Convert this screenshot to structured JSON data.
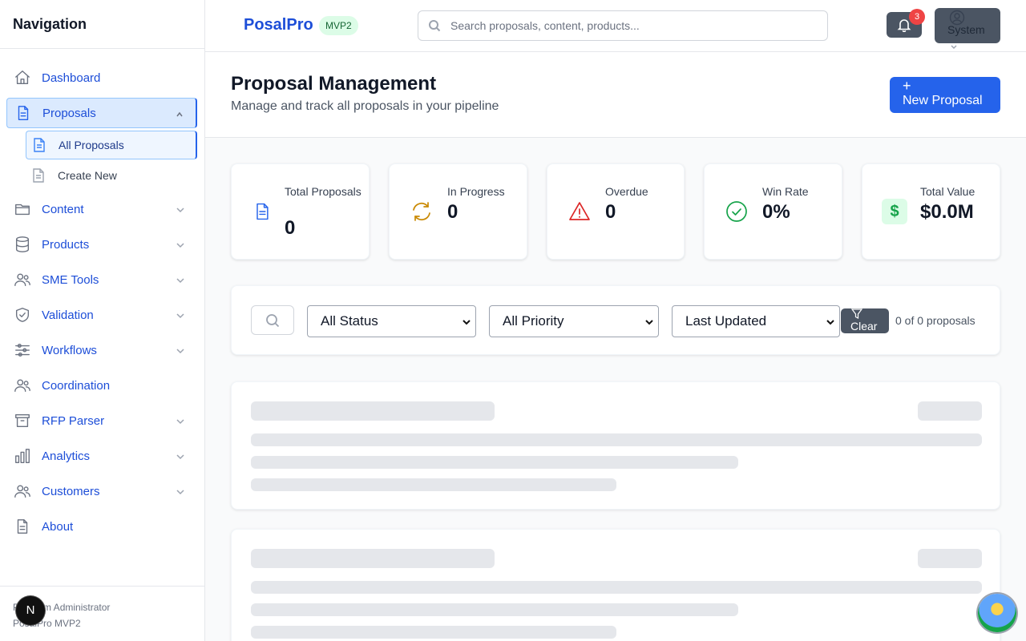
{
  "sidebar": {
    "title": "Navigation",
    "items": [
      {
        "label": "Dashboard",
        "icon": "home-icon"
      },
      {
        "label": "Proposals",
        "icon": "document-icon"
      },
      {
        "label": "Content",
        "icon": "folder-icon"
      },
      {
        "label": "Products",
        "icon": "database-icon"
      },
      {
        "label": "SME Tools",
        "icon": "users-icon"
      },
      {
        "label": "Validation",
        "icon": "shield-check-icon"
      },
      {
        "label": "Workflows",
        "icon": "sliders-icon"
      },
      {
        "label": "Coordination",
        "icon": "users-icon"
      },
      {
        "label": "RFP Parser",
        "icon": "archive-icon"
      },
      {
        "label": "Analytics",
        "icon": "bar-chart-icon"
      },
      {
        "label": "Customers",
        "icon": "users-icon"
      },
      {
        "label": "About",
        "icon": "document-icon"
      }
    ],
    "proposals_sub": [
      {
        "label": "All Proposals"
      },
      {
        "label": "Create New"
      }
    ],
    "footer": {
      "line1": "PSystem Administrator",
      "line2": "PosalPro MVP2"
    },
    "n_badge": "N"
  },
  "header": {
    "brand": "PosalPro",
    "badge": "MVP2",
    "search_placeholder": "Search proposals, content, products...",
    "notification_count": "3",
    "user_label": "System"
  },
  "page": {
    "title": "Proposal Management",
    "subtitle": "Manage and track all proposals in your pipeline",
    "new_button": "New Proposal",
    "new_button_icon": "+"
  },
  "stats": [
    {
      "label": "Total Proposals",
      "value": "0",
      "icon": "document-icon",
      "color": "#2563eb"
    },
    {
      "label": "In Progress",
      "value": "0",
      "icon": "refresh-icon",
      "color": "#ca8a04"
    },
    {
      "label": "Overdue",
      "value": "0",
      "icon": "warning-icon",
      "color": "#dc2626"
    },
    {
      "label": "Win Rate",
      "value": "0%",
      "icon": "check-circle-icon",
      "color": "#16a34a"
    },
    {
      "label": "Total Value",
      "value": "$0.0M",
      "icon": "dollar-icon",
      "color": "#16a34a"
    }
  ],
  "filters": {
    "status": "All Status",
    "priority": "All Priority",
    "sort": "Last Updated",
    "clear": "Clear",
    "count": "0 of 0 proposals"
  },
  "colors": {
    "accent": "#2563eb",
    "brand": "#1d4ed8",
    "button_dark": "#4b5563"
  }
}
